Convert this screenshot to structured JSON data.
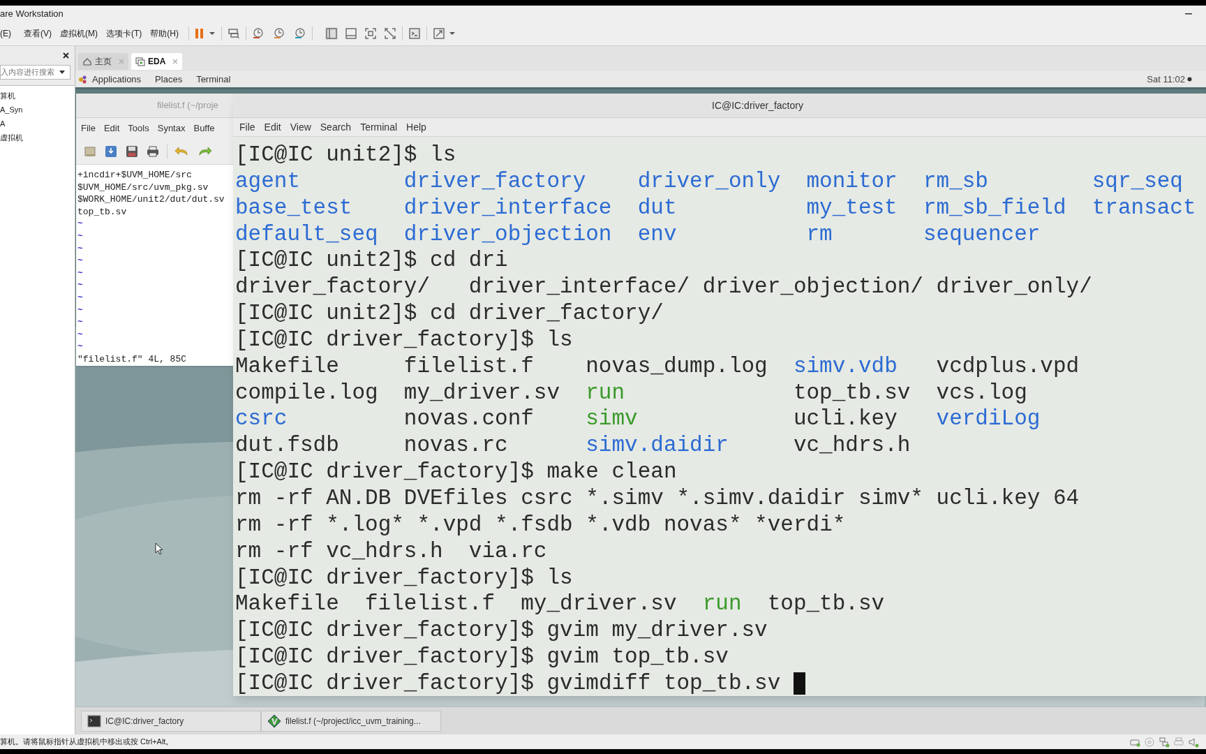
{
  "app": {
    "title": "are Workstation",
    "menu": [
      "(E)",
      "查看(V)",
      "虚拟机(M)",
      "选项卡(T)",
      "帮助(H)"
    ]
  },
  "library": {
    "search": {
      "placeholder": "入内容进行搜索"
    },
    "items": [
      "算机",
      "A_Syn",
      "A",
      "虚拟机"
    ]
  },
  "tabs": [
    {
      "label": "主页",
      "kind": "home",
      "selected": false
    },
    {
      "label": "EDA",
      "kind": "vm",
      "selected": true
    }
  ],
  "top_bar": {
    "menus": [
      "Applications",
      "Places",
      "Terminal"
    ],
    "clock": "Sat 11:02"
  },
  "gvim": {
    "title": "filelist.f (~/proje",
    "menu": [
      "File",
      "Edit",
      "Tools",
      "Syntax",
      "Buffe"
    ],
    "lines": [
      "+incdir+$UVM_HOME/src",
      "$UVM_HOME/src/uvm_pkg.sv",
      "$WORK_HOME/unit2/dut/dut.sv",
      "top_tb.sv"
    ],
    "filler": [
      "~",
      "~",
      "~",
      "~",
      "~",
      "~",
      "~",
      "~",
      "~",
      "~",
      "~"
    ],
    "message": "\"filelist.f\" 4L, 85C"
  },
  "terminal": {
    "title": "IC@IC:driver_factory",
    "menu": [
      "File",
      "Edit",
      "View",
      "Search",
      "Terminal",
      "Help"
    ],
    "blocks": [
      {
        "kind": "line",
        "text": "[IC@IC unit2]$ ls",
        "cursor": false
      },
      {
        "kind": "grid",
        "rows": [
          [
            {
              "text": "agent",
              "color": "#2c6bd3"
            },
            {
              "text": "driver_factory",
              "color": "#2c6bd3"
            },
            {
              "text": "driver_only",
              "color": "#2c6bd3"
            },
            {
              "text": "monitor",
              "color": "#2c6bd3"
            },
            {
              "text": "rm_sb",
              "color": "#2c6bd3"
            },
            {
              "text": "sqr_seq",
              "color": "#2c6bd3"
            }
          ],
          [
            {
              "text": "base_test",
              "color": "#2c6bd3"
            },
            {
              "text": "driver_interface",
              "color": "#2c6bd3"
            },
            {
              "text": "dut",
              "color": "#2c6bd3"
            },
            {
              "text": "my_test",
              "color": "#2c6bd3"
            },
            {
              "text": "rm_sb_field",
              "color": "#2c6bd3"
            },
            {
              "text": "transact",
              "color": "#2c6bd3"
            }
          ],
          [
            {
              "text": "default_seq",
              "color": "#2c6bd3"
            },
            {
              "text": "driver_objection",
              "color": "#2c6bd3"
            },
            {
              "text": "env",
              "color": "#2c6bd3"
            },
            {
              "text": "rm",
              "color": "#2c6bd3"
            },
            {
              "text": "sequencer",
              "color": "#2c6bd3"
            }
          ]
        ]
      },
      {
        "kind": "line",
        "text": "[IC@IC unit2]$ cd dri",
        "cursor": false
      },
      {
        "kind": "line",
        "text": "driver_factory/   driver_interface/ driver_objection/ driver_only/",
        "cursor": false
      },
      {
        "kind": "line",
        "text": "[IC@IC unit2]$ cd driver_factory/",
        "cursor": false
      },
      {
        "kind": "line",
        "text": "[IC@IC driver_factory]$ ls",
        "cursor": false
      },
      {
        "kind": "grid",
        "rows": [
          [
            {
              "text": "Makefile",
              "color": "#2b2b2b"
            },
            {
              "text": "filelist.f",
              "color": "#2b2b2b"
            },
            {
              "text": "novas_dump.log",
              "color": "#2b2b2b"
            },
            {
              "text": "simv.vdb",
              "color": "#2c6bd3"
            },
            {
              "text": "vcdplus.vpd",
              "color": "#2b2b2b"
            }
          ],
          [
            {
              "text": "compile.log",
              "color": "#2b2b2b"
            },
            {
              "text": "my_driver.sv",
              "color": "#2b2b2b"
            },
            {
              "text": "run",
              "color": "#3b9a2c"
            },
            {
              "text": "top_tb.sv",
              "color": "#2b2b2b"
            },
            {
              "text": "vcs.log",
              "color": "#2b2b2b"
            }
          ],
          [
            {
              "text": "csrc",
              "color": "#2c6bd3"
            },
            {
              "text": "novas.conf",
              "color": "#2b2b2b"
            },
            {
              "text": "simv",
              "color": "#3b9a2c"
            },
            {
              "text": "ucli.key",
              "color": "#2b2b2b"
            },
            {
              "text": "verdiLog",
              "color": "#2c6bd3"
            }
          ],
          [
            {
              "text": "dut.fsdb",
              "color": "#2b2b2b"
            },
            {
              "text": "novas.rc",
              "color": "#2b2b2b"
            },
            {
              "text": "simv.daidir",
              "color": "#2c6bd3"
            },
            {
              "text": "vc_hdrs.h",
              "color": "#2b2b2b"
            }
          ]
        ]
      },
      {
        "kind": "line",
        "text": "[IC@IC driver_factory]$ make clean",
        "cursor": false
      },
      {
        "kind": "line",
        "text": "rm -rf AN.DB DVEfiles csrc *.simv *.simv.daidir simv* ucli.key 64",
        "cursor": false
      },
      {
        "kind": "line",
        "text": "rm -rf *.log* *.vpd *.fsdb *.vdb novas* *verdi*",
        "cursor": false
      },
      {
        "kind": "line",
        "text": "rm -rf vc_hdrs.h  via.rc",
        "cursor": false
      },
      {
        "kind": "line",
        "text": "[IC@IC driver_factory]$ ls",
        "cursor": false
      },
      {
        "kind": "grid",
        "rows": [
          [
            {
              "text": "Makefile",
              "color": "#2b2b2b"
            },
            {
              "text": "filelist.f",
              "color": "#2b2b2b"
            },
            {
              "text": "my_driver.sv",
              "color": "#2b2b2b"
            },
            {
              "text": "run",
              "color": "#3b9a2c"
            },
            {
              "text": "top_tb.sv",
              "color": "#2b2b2b"
            }
          ]
        ]
      },
      {
        "kind": "line",
        "text": "[IC@IC driver_factory]$ gvim my_driver.sv",
        "cursor": false
      },
      {
        "kind": "line",
        "text": "[IC@IC driver_factory]$ gvim top_tb.sv",
        "cursor": false
      },
      {
        "kind": "line",
        "text": "[IC@IC driver_factory]$ gvimdiff top_tb.sv",
        "cursor": true
      }
    ]
  },
  "taskbar": [
    {
      "kind": "terminal",
      "label": "IC@IC:driver_factory"
    },
    {
      "kind": "editor",
      "label": "filelist.f (~/project/icc_uvm_training..."
    }
  ],
  "status_bar": "算机。请将鼠标指针从虚拟机中移出或按 Ctrl+Alt。"
}
